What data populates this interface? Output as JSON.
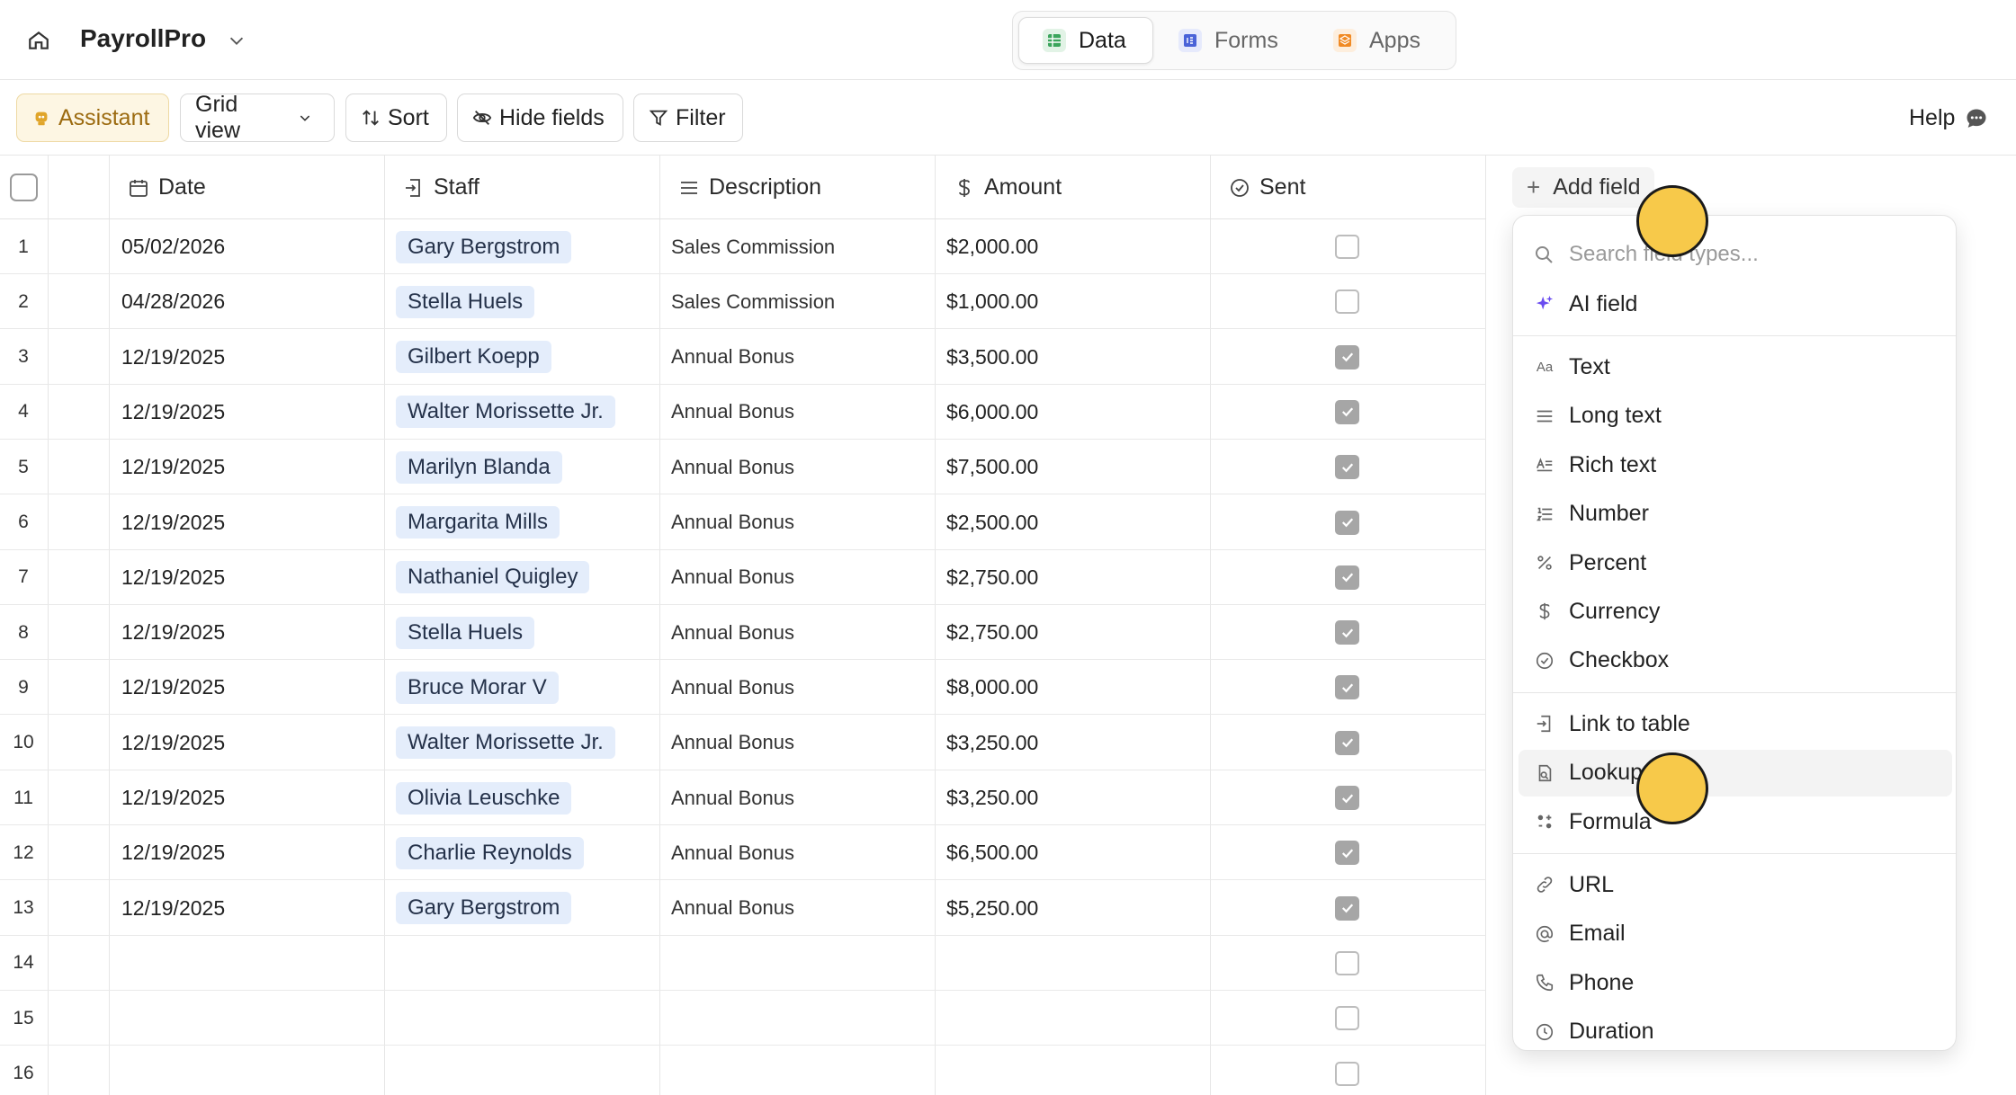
{
  "app": {
    "title": "PayrollPro"
  },
  "tabs": [
    {
      "label": "Data",
      "icon": "table-icon",
      "active": true
    },
    {
      "label": "Forms",
      "icon": "form-icon",
      "active": false
    },
    {
      "label": "Apps",
      "icon": "apps-icon",
      "active": false
    }
  ],
  "toolbar": {
    "assistant": "Assistant",
    "grid_view": "Grid view",
    "sort": "Sort",
    "hide_fields": "Hide fields",
    "filter": "Filter",
    "help": "Help"
  },
  "columns": {
    "date": "Date",
    "staff": "Staff",
    "description": "Description",
    "amount": "Amount",
    "sent": "Sent",
    "add_field": "Add field"
  },
  "rows": [
    {
      "n": "1",
      "date": "05/02/2026",
      "staff": "Gary Bergstrom",
      "description": "Sales Commission",
      "amount": "$2,000.00",
      "sent": false
    },
    {
      "n": "2",
      "date": "04/28/2026",
      "staff": "Stella Huels",
      "description": "Sales Commission",
      "amount": "$1,000.00",
      "sent": false
    },
    {
      "n": "3",
      "date": "12/19/2025",
      "staff": "Gilbert Koepp",
      "description": "Annual Bonus",
      "amount": "$3,500.00",
      "sent": true
    },
    {
      "n": "4",
      "date": "12/19/2025",
      "staff": "Walter Morissette Jr.",
      "description": "Annual Bonus",
      "amount": "$6,000.00",
      "sent": true
    },
    {
      "n": "5",
      "date": "12/19/2025",
      "staff": "Marilyn Blanda",
      "description": "Annual Bonus",
      "amount": "$7,500.00",
      "sent": true
    },
    {
      "n": "6",
      "date": "12/19/2025",
      "staff": "Margarita Mills",
      "description": "Annual Bonus",
      "amount": "$2,500.00",
      "sent": true
    },
    {
      "n": "7",
      "date": "12/19/2025",
      "staff": "Nathaniel Quigley",
      "description": "Annual Bonus",
      "amount": "$2,750.00",
      "sent": true
    },
    {
      "n": "8",
      "date": "12/19/2025",
      "staff": "Stella Huels",
      "description": "Annual Bonus",
      "amount": "$2,750.00",
      "sent": true
    },
    {
      "n": "9",
      "date": "12/19/2025",
      "staff": "Bruce Morar V",
      "description": "Annual Bonus",
      "amount": "$8,000.00",
      "sent": true
    },
    {
      "n": "10",
      "date": "12/19/2025",
      "staff": "Walter Morissette Jr.",
      "description": "Annual Bonus",
      "amount": "$3,250.00",
      "sent": true
    },
    {
      "n": "11",
      "date": "12/19/2025",
      "staff": "Olivia Leuschke",
      "description": "Annual Bonus",
      "amount": "$3,250.00",
      "sent": true
    },
    {
      "n": "12",
      "date": "12/19/2025",
      "staff": "Charlie Reynolds",
      "description": "Annual Bonus",
      "amount": "$6,500.00",
      "sent": true
    },
    {
      "n": "13",
      "date": "12/19/2025",
      "staff": "Gary Bergstrom",
      "description": "Annual Bonus",
      "amount": "$5,250.00",
      "sent": true
    },
    {
      "n": "14",
      "date": "",
      "staff": "",
      "description": "",
      "amount": "",
      "sent": false
    },
    {
      "n": "15",
      "date": "",
      "staff": "",
      "description": "",
      "amount": "",
      "sent": false
    },
    {
      "n": "16",
      "date": "",
      "staff": "",
      "description": "",
      "amount": "",
      "sent": false
    }
  ],
  "field_menu": {
    "search_placeholder": "Search field types...",
    "groups": [
      [
        {
          "label": "AI field",
          "icon": "sparkle-icon"
        }
      ],
      [
        {
          "label": "Text",
          "icon": "text-icon"
        },
        {
          "label": "Long text",
          "icon": "long-text-icon"
        },
        {
          "label": "Rich text",
          "icon": "rich-text-icon"
        },
        {
          "label": "Number",
          "icon": "number-icon"
        },
        {
          "label": "Percent",
          "icon": "percent-icon"
        },
        {
          "label": "Currency",
          "icon": "currency-icon"
        },
        {
          "label": "Checkbox",
          "icon": "checkbox-icon"
        }
      ],
      [
        {
          "label": "Link to table",
          "icon": "link-table-icon"
        },
        {
          "label": "Lookup",
          "icon": "lookup-icon",
          "hover": true
        },
        {
          "label": "Formula",
          "icon": "formula-icon"
        }
      ],
      [
        {
          "label": "URL",
          "icon": "url-icon"
        },
        {
          "label": "Email",
          "icon": "email-icon"
        },
        {
          "label": "Phone",
          "icon": "phone-icon"
        },
        {
          "label": "Duration",
          "icon": "duration-icon"
        }
      ]
    ]
  },
  "colors": {
    "chip_bg": "#e4edfb",
    "assistant_bg": "#fdf6e3",
    "cursor": "#f7c94a"
  }
}
